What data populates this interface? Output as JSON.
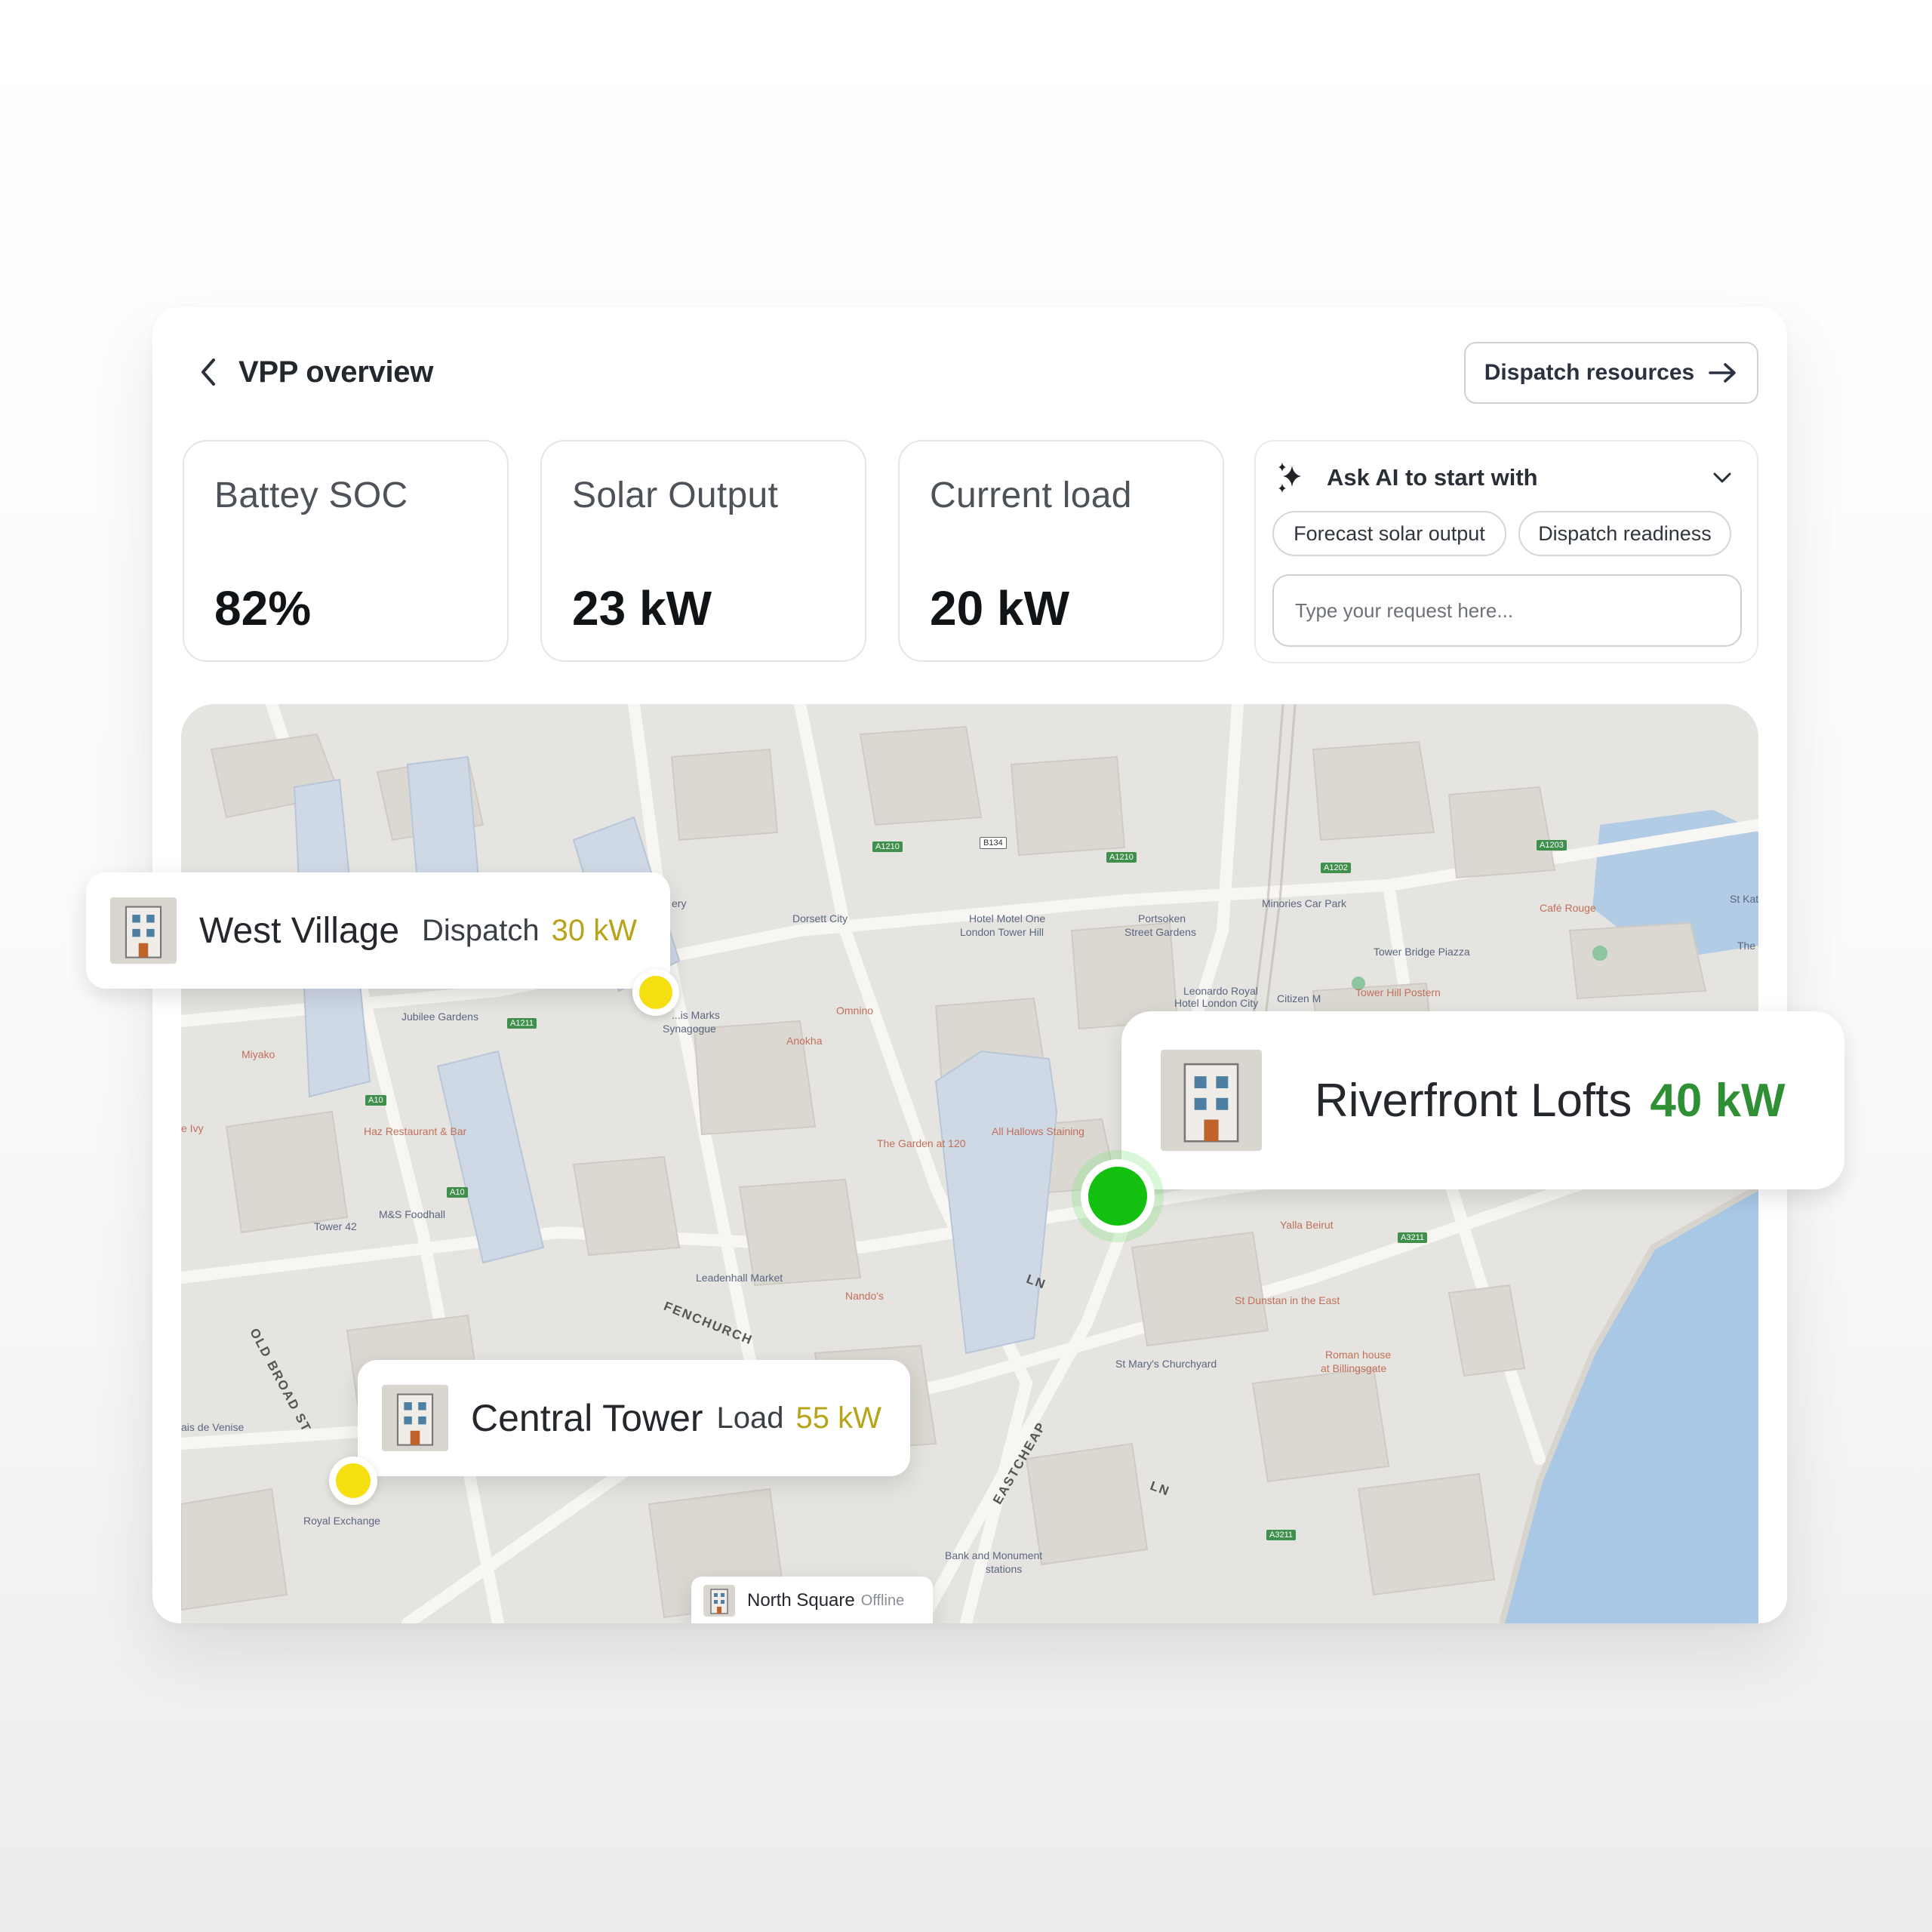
{
  "header": {
    "title": "VPP overview",
    "dispatch_button_label": "Dispatch resources"
  },
  "metrics": [
    {
      "label": "Battey SOC",
      "value": "82%"
    },
    {
      "label": "Solar Output",
      "value": "23 kW"
    },
    {
      "label": "Current load",
      "value": "20 kW"
    }
  ],
  "ai_panel": {
    "title": "Ask AI to start with",
    "suggestions": [
      "Forecast solar output",
      "Dispatch readiness"
    ],
    "input_placeholder": "Type your request here..."
  },
  "map": {
    "sites": [
      {
        "name": "West Village",
        "action": "Dispatch",
        "power": "30 kW",
        "status_color": "#f5df10"
      },
      {
        "name": "Riverfront Lofts",
        "power": "40 kW",
        "status_color": "#13c010"
      },
      {
        "name": "Central Tower",
        "action": "Load",
        "power": "55 kW",
        "status_color": "#f5df10"
      },
      {
        "name": "North Square",
        "status": "Offline"
      }
    ],
    "labels": {
      "dorsett_city": "Dorsett City",
      "hotel_motel_one_1": "Hotel Motel One",
      "hotel_motel_one_2": "London Tower Hill",
      "portsoken_1": "Portsoken",
      "portsoken_2": "Street Gardens",
      "minories": "Minories Car Park",
      "tower_bridge_piazza": "Tower Bridge Piazza",
      "cafe_rouge": "Café Rouge",
      "leonardo_1": "Leonardo Royal",
      "leonardo_2": "Hotel London City",
      "citizen_m": "Citizen M",
      "tower_hill_postern": "Tower Hill Postern",
      "synagogue_1": "...is Marks",
      "synagogue_2": "Synagogue",
      "omnino": "Omnino",
      "anokha": "Anokha",
      "jubilee_gardens": "Jubilee Gardens",
      "miyako": "Miyako",
      "haz": "Haz Restaurant & Bar",
      "ivy": "e Ivy",
      "garden_120": "The Garden at 120",
      "all_hallows": "All Hallows Staining",
      "ms_foodhall": "M&S Foodhall",
      "tower_42": "Tower 42",
      "leadenhall": "Leadenhall Market",
      "nandos": "Nando's",
      "yalla_beirut": "Yalla Beirut",
      "st_dunstan": "St Dunstan in the East",
      "st_marys": "St Mary's Churchyard",
      "roman_house_1": "Roman house",
      "roman_house_2": "at Billingsgate",
      "palais_de_venise": "ais de Venise",
      "royal_exchange": "Royal Exchange",
      "bank_monument_1": "Bank and Monument",
      "bank_monument_2": "stations",
      "old_broad_st": "OLD BROAD ST",
      "fenchurch": "FENCHURCH",
      "eastcheap": "EASTCHEAP",
      "st_kath": "St Kath",
      "the": "The",
      "ery": "ery",
      "ln1": "LN",
      "ln2": "LN"
    },
    "road_shields": {
      "a1210": "A1210",
      "b134": "B134",
      "a1211": "A1211",
      "a1203": "A1203",
      "a1202": "A1202",
      "a3211": "A3211",
      "a10": "A10"
    }
  },
  "colors": {
    "dispatch_yellow": "#f5df10",
    "active_green": "#13c010",
    "river": "#a8c8e6",
    "accent_kw_yellow": "#b7a41a",
    "accent_kw_green": "#2f8f35"
  }
}
